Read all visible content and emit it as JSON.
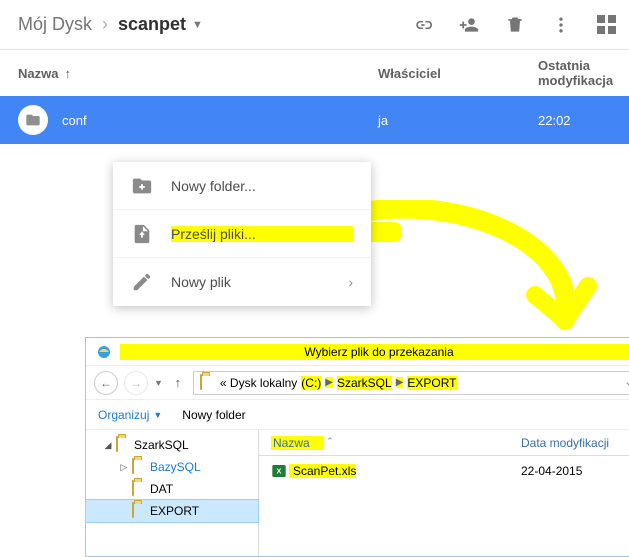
{
  "drive": {
    "breadcrumb": {
      "root": "Mój Dysk",
      "current": "scanpet"
    },
    "headers": {
      "name": "Nazwa",
      "owner": "Właściciel",
      "modified": "Ostatnia modyfikacja"
    },
    "row": {
      "name": "conf",
      "owner": "ja",
      "modified": "22:02"
    },
    "menu": {
      "new_folder": "Nowy folder...",
      "upload_files": "Prześlij pliki...",
      "new_file": "Nowy plik"
    }
  },
  "explorer": {
    "title": "Wybierz plik do przekazania",
    "address": {
      "prefix": "«  Dysk lokalny",
      "drive": "(C:)",
      "seg1": "SzarkSQL",
      "seg2": "EXPORT"
    },
    "toolbar": {
      "organize": "Organizuj",
      "new_folder": "Nowy folder"
    },
    "tree": {
      "root": "SzarkSQL",
      "child1": "BazySQL",
      "child2": "DAT",
      "child3": "EXPORT"
    },
    "list": {
      "headers": {
        "name": "Nazwa",
        "date": "Data modyfikacji"
      },
      "file": {
        "name": "ScanPet.xls",
        "date": "22-04-2015"
      }
    }
  }
}
